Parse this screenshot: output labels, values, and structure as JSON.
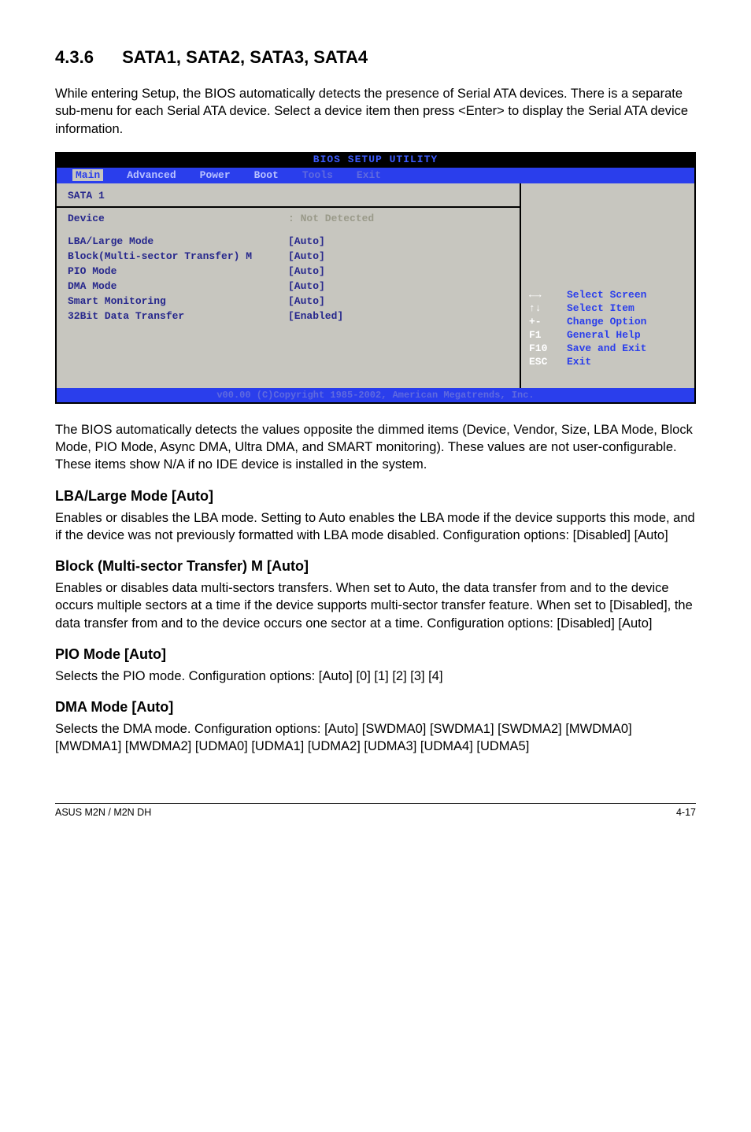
{
  "section": {
    "number": "4.3.6",
    "title": "SATA1, SATA2, SATA3, SATA4"
  },
  "intro": "While entering Setup, the BIOS automatically detects the presence of Serial ATA devices. There is a separate sub-menu for each Serial ATA  device. Select a device item then press <Enter> to display the Serial ATA device information.",
  "bios": {
    "title": "BIOS SETUP UTILITY",
    "tabs": {
      "main": "Main",
      "advanced": "Advanced",
      "power": "Power",
      "boot": "Boot",
      "tools": "Tools",
      "exit": "Exit"
    },
    "device_header": "SATA 1",
    "device_label": "Device",
    "device_value": ": Not Detected",
    "rows": {
      "lba_label": "LBA/Large Mode",
      "lba_value": "[Auto]",
      "block_label": "Block(Multi-sector Transfer) M",
      "block_value": "[Auto]",
      "pio_label": "PIO Mode",
      "pio_value": "[Auto]",
      "dma_label": "DMA Mode",
      "dma_value": "[Auto]",
      "smart_label": "Smart Monitoring",
      "smart_value": "[Auto]",
      "bit32_label": "32Bit Data Transfer",
      "bit32_value": "[Enabled]"
    },
    "help": {
      "k1": "←→",
      "t1": "Select Screen",
      "k2": "↑↓",
      "t2": "Select Item",
      "k3": "+-",
      "t3": "Change Option",
      "k4": "F1",
      "t4": "General Help",
      "k5": "F10",
      "t5": "Save and Exit",
      "k6": "ESC",
      "t6": "Exit"
    },
    "footer": "v00.00 (C)Copyright 1985-2002, American Megatrends, Inc."
  },
  "after_bios": "The BIOS automatically detects the values opposite the dimmed items (Device, Vendor, Size, LBA Mode, Block Mode, PIO Mode, Async DMA, Ultra DMA, and SMART monitoring). These values are not user-configurable. These items show N/A if no IDE device is installed in the system.",
  "lba": {
    "heading": "LBA/Large Mode [Auto]",
    "text": "Enables or disables the LBA mode. Setting to Auto enables the LBA mode if the device supports this mode, and if the device was not previously formatted with LBA mode disabled. Configuration options: [Disabled] [Auto]"
  },
  "block": {
    "heading": "Block (Multi-sector Transfer) M [Auto]",
    "text": "Enables or disables data multi-sectors transfers. When set to Auto, the data transfer from and to the device occurs multiple sectors at a time if the device supports multi-sector transfer feature. When set to [Disabled], the data transfer from and to the device occurs one sector at a time. Configuration options: [Disabled] [Auto]"
  },
  "pio": {
    "heading": "PIO Mode [Auto]",
    "text": "Selects the PIO mode. Configuration options: [Auto] [0] [1] [2] [3] [4]"
  },
  "dma": {
    "heading": "DMA Mode [Auto]",
    "text": "Selects the DMA mode. Configuration options: [Auto] [SWDMA0] [SWDMA1] [SWDMA2] [MWDMA0] [MWDMA1] [MWDMA2] [UDMA0] [UDMA1] [UDMA2] [UDMA3] [UDMA4] [UDMA5]"
  },
  "footer": {
    "left": "ASUS M2N / M2N DH",
    "right": "4-17"
  }
}
